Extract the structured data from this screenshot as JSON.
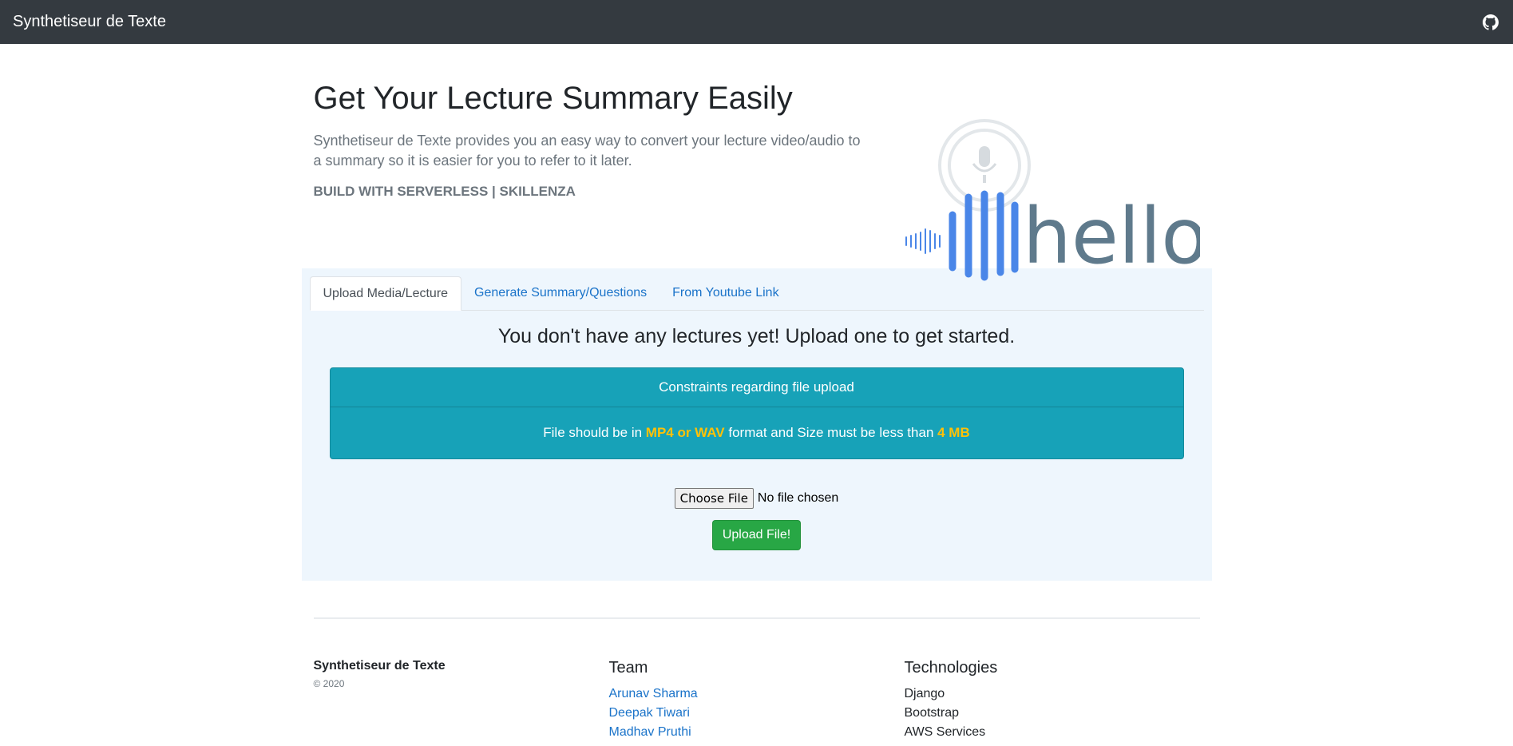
{
  "navbar": {
    "brand": "Synthetiseur de Texte",
    "github_icon": "github-icon"
  },
  "hero": {
    "title": "Get Your Lecture Summary Easily",
    "lead": "Synthetiseur de Texte provides you an easy way to convert your lecture video/audio to a summary so it is easier for you to refer to it later.",
    "tagline": "BUILD WITH SERVERLESS | SKILLENZA",
    "image_word": "hello",
    "image_icon": "microphone-icon"
  },
  "tabs": [
    {
      "label": "Upload Media/Lecture",
      "active": true
    },
    {
      "label": "Generate Summary/Questions",
      "active": false
    },
    {
      "label": "From Youtube Link",
      "active": false
    }
  ],
  "upload_panel": {
    "empty_message": "You don't have any lectures yet! Upload one to get started.",
    "constraints_title": "Constraints regarding file upload",
    "constraint_prefix": "File should be in ",
    "constraint_formats": "MP4 or WAV",
    "constraint_middle": " format and Size must be less than ",
    "constraint_size": "4 MB",
    "choose_label": "Choose File",
    "file_status": "No file chosen",
    "upload_button": "Upload File!"
  },
  "footer": {
    "brand": "Synthetiseur de Texte",
    "copyright": "© 2020",
    "team_heading": "Team",
    "team": [
      "Arunav Sharma",
      "Deepak Tiwari",
      "Madhav Pruthi"
    ],
    "tech_heading": "Technologies",
    "technologies": [
      "Django",
      "Bootstrap",
      "AWS Services"
    ]
  },
  "colors": {
    "navbar": "#343a40",
    "info": "#17a2b8",
    "highlight": "#ffc107",
    "success": "#28a745",
    "link": "#1a73c9",
    "panel": "#eef6fd",
    "wave_blue": "#4a86e8",
    "hello_gray": "#5f7a8c"
  }
}
